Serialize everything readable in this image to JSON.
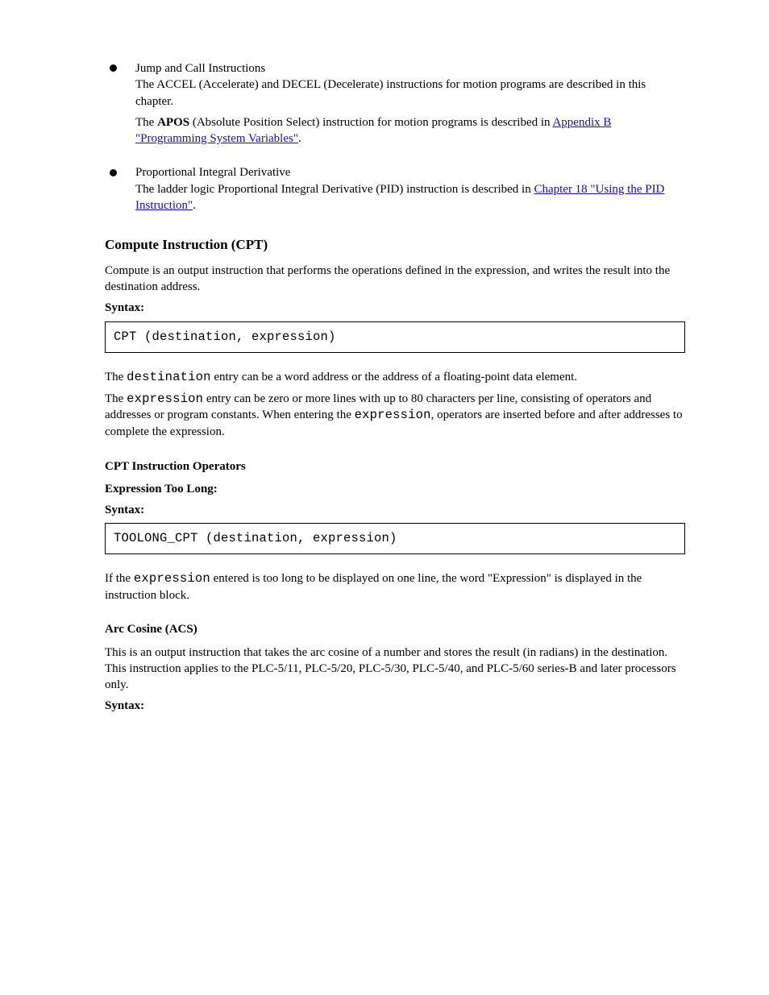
{
  "bullet1": {
    "lead": "Jump and Call Instructions",
    "body1": "The ACCEL (Accelerate) and DECEL (Decelerate) instructions for motion programs are described in this chapter.",
    "body2_pre": "The ",
    "body2_bold": "APOS",
    "body2_mid": " (Absolute Position Select) instruction for motion programs is described in ",
    "link_text": "Appendix B \"Programming System Variables\"",
    "after_link": "."
  },
  "bullet2": {
    "lead": "Proportional Integral Derivative",
    "body_pre": "The ladder logic Proportional Integral Derivative (PID) instruction is described in ",
    "link_text": "Chapter 18 \"Using the PID Instruction\"",
    "after_link": "."
  },
  "section_title": "Compute Instruction (CPT)",
  "compute": {
    "p1": "Compute is an output instruction that performs the operations defined in the expression, and writes the result into the destination address.",
    "syn_label": "Syntax:",
    "box": "CPT (destination, expression)",
    "p2_pre": "The ",
    "p2_mono": "destination",
    "p2_after": " entry can be a word address or the address of a floating-point data element.",
    "p3_pre": "The ",
    "p3_mono": "expression",
    "p3_post": " entry can be zero or more lines with up to 80 characters per line, consisting of operators and addresses or program constants. When entering the ",
    "p3_mono2": "expression",
    "p3_tail": ", operators are inserted before and after addresses to complete the expression."
  },
  "cpt_sub_title": "CPT Instruction Operators",
  "toolong": {
    "label": "Expression Too Long:",
    "syn_label": "Syntax:",
    "box": "TOOLONG_CPT (destination, expression)",
    "p_pre": "If the ",
    "p_mono": "expression",
    "p_post": " entered is too long to be displayed on one line, the word \"Expression\" is displayed in the instruction block."
  },
  "acs_sub_title": "Arc Cosine (ACS)",
  "acs": {
    "p": "This is an output instruction that takes the arc cosine of a number and stores the result (in radians) in the destination. This instruction applies to the PLC-5/11, PLC-5/20, PLC-5/30, PLC-5/40, and PLC-5/60 series-B and later processors only.",
    "syn_label": "Syntax:"
  }
}
